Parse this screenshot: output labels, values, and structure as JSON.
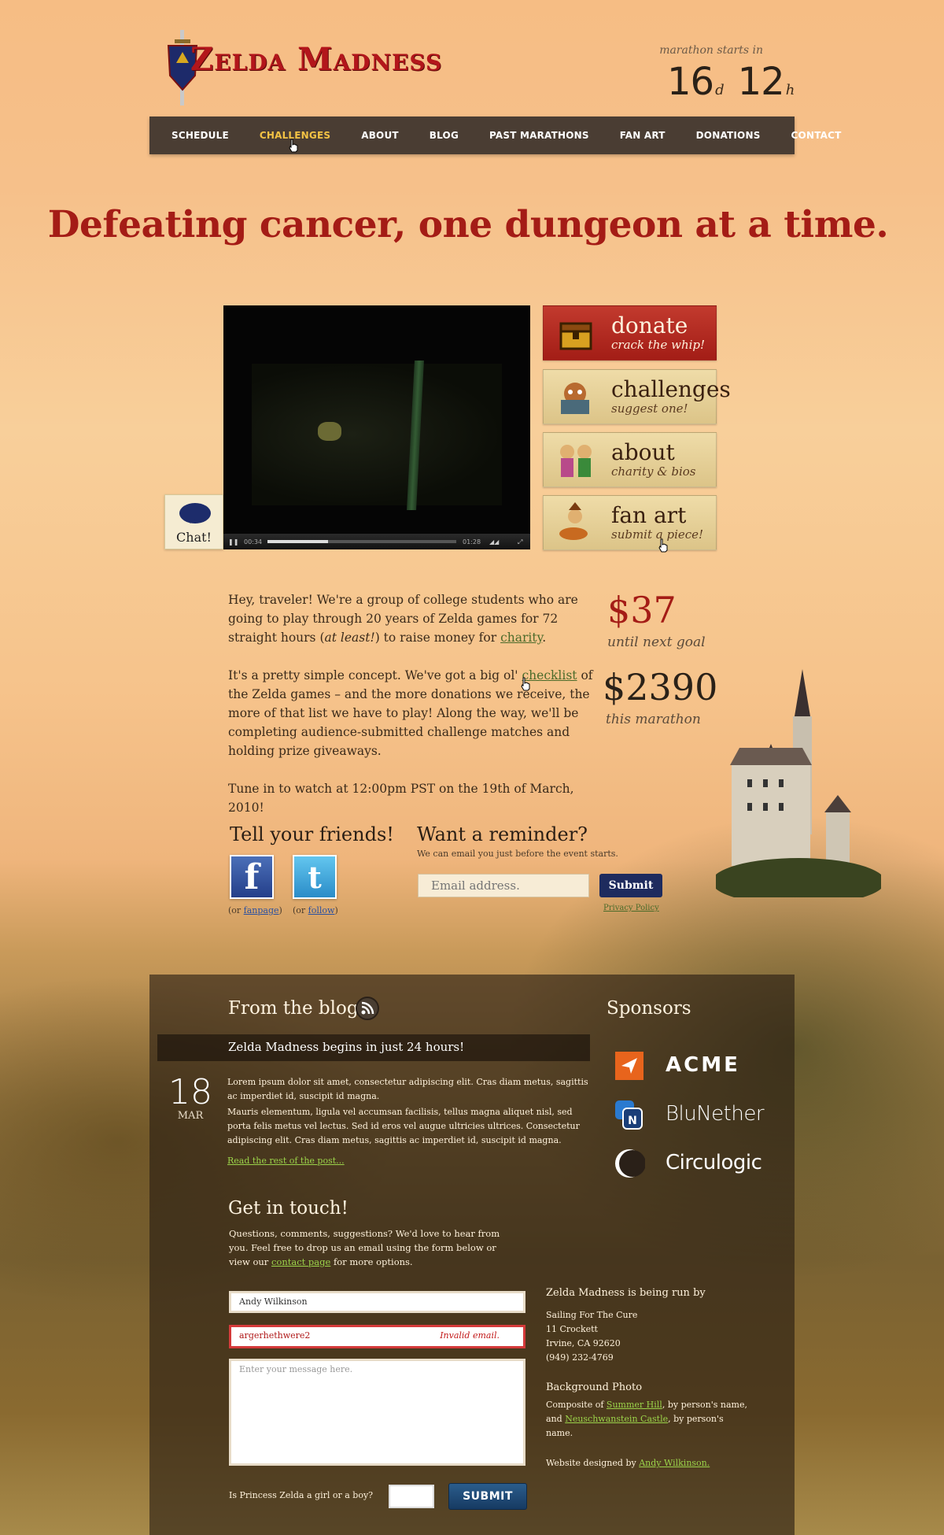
{
  "header": {
    "logo_text": "Zelda Madness",
    "countdown_label": "marathon starts in",
    "countdown_days": "16",
    "countdown_days_unit": "d",
    "countdown_hours": "12",
    "countdown_hours_unit": "h"
  },
  "nav": {
    "items": [
      "SCHEDULE",
      "CHALLENGES",
      "ABOUT",
      "BLOG",
      "PAST MARATHONS",
      "FAN ART",
      "DONATIONS",
      "CONTACT"
    ],
    "active": "CHALLENGES"
  },
  "hero": {
    "tagline": "Defeating cancer, one dungeon at a time."
  },
  "video": {
    "current_time": "00:34",
    "duration": "01:28",
    "progress": 0.32
  },
  "chat": {
    "label": "Chat!"
  },
  "side_buttons": [
    {
      "title": "donate",
      "sub": "crack the whip!"
    },
    {
      "title": "challenges",
      "sub": "suggest one!"
    },
    {
      "title": "about",
      "sub": "charity & bios"
    },
    {
      "title": "fan art",
      "sub": "submit a piece!"
    }
  ],
  "intro": {
    "p1_a": "Hey, traveler! We're a group of college students who are going to play through 20 years of Zelda games for 72 straight hours (",
    "p1_em": "at least!",
    "p1_b": ") to raise money for ",
    "p1_link": "charity",
    "p1_c": ".",
    "p2_a": "It's a pretty simple concept. We've got a big ol' ",
    "p2_link": "checklist",
    "p2_b": " of the Zelda games – and the more donations we receive, the more of that list we have to play! Along the way, we'll be completing audience-submitted challenge matches and holding prize giveaways.",
    "p3": "Tune in to watch at 12:00pm PST on the 19th of March, 2010!"
  },
  "stats": {
    "next_goal_value": "$37",
    "next_goal_label": "until next goal",
    "total_value": "$2390",
    "total_label": "this marathon"
  },
  "social": {
    "heading": "Tell your friends!",
    "fb_glyph": "f",
    "tw_glyph": "t",
    "fb_note_a": "(or ",
    "fb_note_link": "fanpage",
    "fb_note_b": ")",
    "tw_note_a": "(or ",
    "tw_note_link": "follow",
    "tw_note_b": ")"
  },
  "reminder": {
    "heading": "Want a reminder?",
    "sub": "We can email you just before the event starts.",
    "placeholder": "Email address.",
    "submit": "Submit",
    "privacy": "Privacy Policy"
  },
  "blog": {
    "heading": "From the blog",
    "post_title": "Zelda Madness begins in just 24 hours!",
    "date_day": "18",
    "date_month": "MAR",
    "p1": "Lorem ipsum dolor sit amet, consectetur adipiscing elit. Cras diam metus, sagittis ac imperdiet id, suscipit id magna.",
    "p2": "Mauris elementum, ligula vel accumsan facilisis, tellus magna aliquet nisl, sed porta felis metus vel lectus. Sed id eros vel augue ultricies ultrices. Consectetur adipiscing elit. Cras diam metus, sagittis ac imperdiet id, suscipit id magna.",
    "read_more": "Read the rest of the post..."
  },
  "sponsors": {
    "heading": "Sponsors",
    "items": [
      "ACME",
      "BluNether",
      "Circulogic"
    ]
  },
  "contact": {
    "heading": "Get in touch!",
    "text_a": "Questions, comments, suggestions? We'd love to hear from you. Feel free to drop us an email using the form below or view our ",
    "text_link": "contact page",
    "text_b": " for more options.",
    "name_value": "Andy Wilkinson",
    "email_value": "argerhethwere2",
    "email_error": "Invalid email.",
    "message_placeholder": "Enter your message here.",
    "question": "Is Princess Zelda a girl or a boy?",
    "submit": "SUBMIT"
  },
  "credits": {
    "run_by_heading": "Zelda Madness is being run by",
    "org": "Sailing For The Cure",
    "street": "11 Crockett",
    "city": "Irvine, CA 92620",
    "phone": "(949) 232-4769",
    "bg_heading": "Background Photo",
    "bg_a": "Composite of ",
    "bg_link1": "Summer Hill",
    "bg_b": ", by person's name, and ",
    "bg_link2": "Neuschwanstein Castle",
    "bg_c": ", by person's name.",
    "design_a": "Website designed by ",
    "design_link": "Andy Wilkinson."
  },
  "colors": {
    "accent_red": "#a41c16",
    "nav_bg": "#4a3d33",
    "nav_active": "#f3c244",
    "link_green": "#9bd34a"
  }
}
